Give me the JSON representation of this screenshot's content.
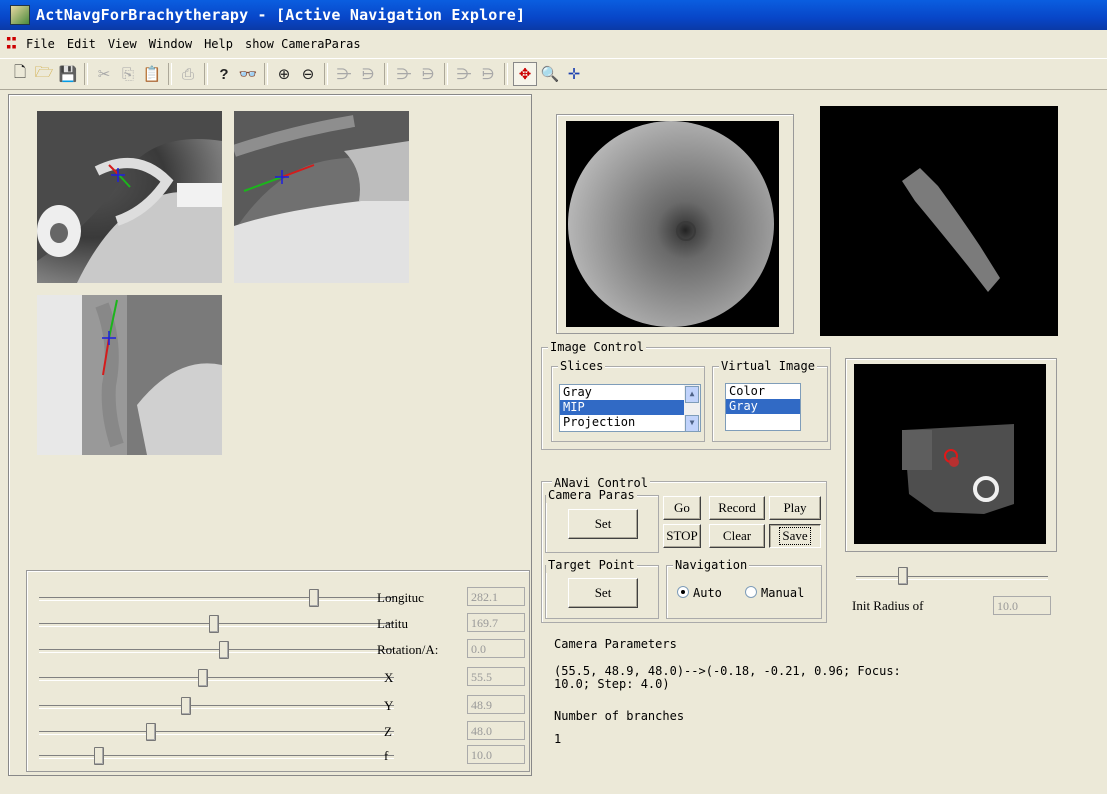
{
  "window": {
    "title": "ActNavgForBrachytherapy - [Active Navigation Explore]"
  },
  "menu": [
    "File",
    "Edit",
    "View",
    "Window",
    "Help",
    "show CameraParas"
  ],
  "sliders": [
    {
      "label": "Longituc",
      "value": "282.1",
      "pos": 0.79
    },
    {
      "label": "Latitu",
      "value": "169.7",
      "pos": 0.5
    },
    {
      "label": "Rotation/A:",
      "value": "0.0",
      "pos": 0.53
    },
    {
      "label": "X",
      "value": "55.5",
      "pos": 0.47
    },
    {
      "label": "Y",
      "value": "48.9",
      "pos": 0.42
    },
    {
      "label": "Z",
      "value": "48.0",
      "pos": 0.32
    },
    {
      "label": "f",
      "value": "10.0",
      "pos": 0.17
    }
  ],
  "image_control": {
    "title": "Image Control",
    "slices": {
      "title": "Slices",
      "items": [
        "Gray",
        "MIP",
        "Projection"
      ],
      "selected": "MIP"
    },
    "virtual": {
      "title": "Virtual Image",
      "items": [
        "Color",
        "Gray"
      ],
      "selected": "Gray"
    }
  },
  "anavi": {
    "title": "ANavi Control",
    "camera_title": "Camera Paras",
    "set_label": "Set",
    "go": "Go",
    "stop": "STOP",
    "record": "Record",
    "play": "Play",
    "clear": "Clear",
    "save": "Save",
    "target_title": "Target Point",
    "target_set": "Set",
    "nav_title": "Navigation",
    "auto": "Auto",
    "manual": "Manual",
    "nav_selected": "Auto"
  },
  "init_radius": {
    "label": "Init Radius of",
    "value": "10.0",
    "pos": 0.25
  },
  "camera_info": {
    "heading": "Camera Parameters",
    "line1": "(55.5, 48.9, 48.0)-->(-0.18, -0.21, 0.96; Focus:",
    "line2": "10.0; Step: 4.0)",
    "branches_label": "Number of branches",
    "branches_value": "1"
  }
}
